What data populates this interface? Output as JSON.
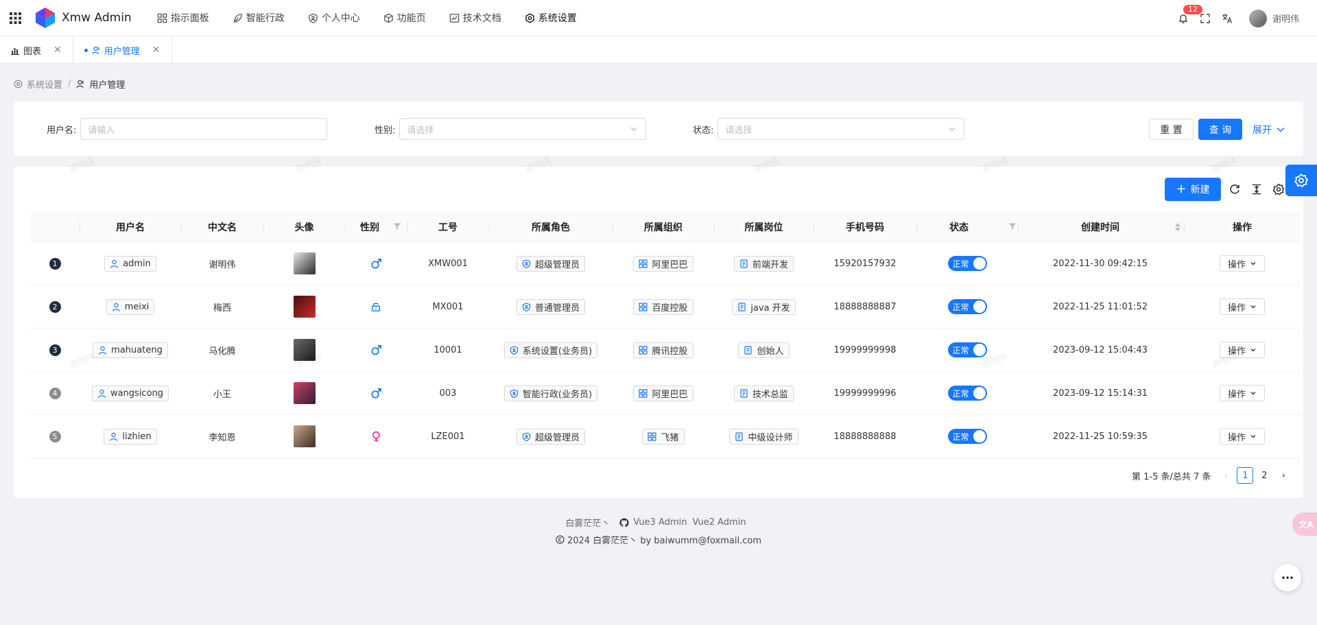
{
  "app": {
    "title": "Xmw Admin"
  },
  "nav": [
    {
      "label": "指示面板",
      "icon": "dashboard-icon"
    },
    {
      "label": "智能行政",
      "icon": "leaf-icon"
    },
    {
      "label": "个人中心",
      "icon": "shield-user-icon"
    },
    {
      "label": "功能页",
      "icon": "box-icon"
    },
    {
      "label": "技术文档",
      "icon": "doc-icon"
    },
    {
      "label": "系统设置",
      "icon": "gear-icon"
    }
  ],
  "header": {
    "notification_count": "12",
    "user_name": "谢明伟"
  },
  "tabs": [
    {
      "label": "图表"
    },
    {
      "label": "用户管理"
    }
  ],
  "breadcrumb": {
    "parent": "系统设置",
    "sep": "/",
    "current": "用户管理"
  },
  "search": {
    "username_label": "用户名:",
    "username_placeholder": "请输入",
    "gender_label": "性别:",
    "gender_placeholder": "请选择",
    "status_label": "状态:",
    "status_placeholder": "请选择",
    "reset": "重 置",
    "query": "查 询",
    "expand": "展开"
  },
  "toolbar": {
    "new": "新建"
  },
  "columns": [
    "用户名",
    "中文名",
    "头像",
    "性别",
    "工号",
    "所属角色",
    "所属组织",
    "所属岗位",
    "手机号码",
    "状态",
    "创建时间",
    "操作"
  ],
  "rows": [
    {
      "idx": "1",
      "username": "admin",
      "cn": "谢明伟",
      "gender": "male",
      "no": "XMW001",
      "role": "超级管理员",
      "org": "阿里巴巴",
      "post": "前端开发",
      "phone": "15920157932",
      "status": "正常",
      "created": "2022-11-30 09:42:15",
      "op": "操作",
      "idx_color": "#1f2d3d"
    },
    {
      "idx": "2",
      "username": "meixi",
      "cn": "梅西",
      "gender": "secret",
      "no": "MX001",
      "role": "普通管理员",
      "org": "百度控股",
      "post": "java 开发",
      "phone": "18888888887",
      "status": "正常",
      "created": "2022-11-25 11:01:52",
      "op": "操作",
      "idx_color": "#1f2d3d"
    },
    {
      "idx": "3",
      "username": "mahuateng",
      "cn": "马化腾",
      "gender": "male",
      "no": "10001",
      "role": "系统设置(业务员)",
      "org": "腾讯控股",
      "post": "创始人",
      "phone": "19999999998",
      "status": "正常",
      "created": "2023-09-12 15:04:43",
      "op": "操作",
      "idx_color": "#1f2d3d"
    },
    {
      "idx": "4",
      "username": "wangsicong",
      "cn": "小王",
      "gender": "male",
      "no": "003",
      "role": "智能行政(业务员)",
      "org": "阿里巴巴",
      "post": "技术总监",
      "phone": "19999999996",
      "status": "正常",
      "created": "2023-09-12 15:14:31",
      "op": "操作",
      "idx_color": "#8c8c8c"
    },
    {
      "idx": "5",
      "username": "lizhien",
      "cn": "李知恩",
      "gender": "female",
      "no": "LZE001",
      "role": "超级管理员",
      "org": "飞猪",
      "post": "中级设计师",
      "phone": "18888888888",
      "status": "正常",
      "created": "2022-11-25 10:59:35",
      "op": "操作",
      "idx_color": "#8c8c8c"
    }
  ],
  "pagination": {
    "summary": "第 1-5 条/总共 7 条",
    "pages": [
      "1",
      "2"
    ]
  },
  "footer": {
    "author": "白雾茫茫丶",
    "link1": "Vue3 Admin",
    "link2": "Vue2 Admin",
    "copyright": "2024 白雾茫茫丶 by baiwumm@foxmail.com"
  },
  "watermark": "谢明伟",
  "colors": {
    "primary": "#1677ff",
    "male": "#1677ff",
    "female": "#eb2f96"
  }
}
